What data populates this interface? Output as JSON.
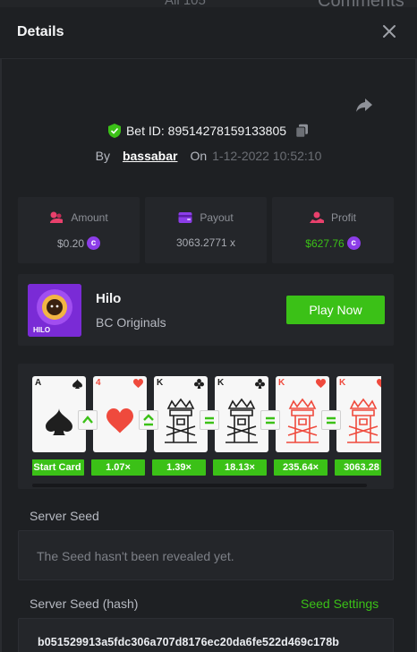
{
  "background_header": {
    "left_text": "All 105",
    "right_text": "Comments"
  },
  "header": {
    "title": "Details",
    "close_icon": "close-icon"
  },
  "share_icon": "share-icon",
  "bet": {
    "id_label": "Bet ID: 89514278159133805",
    "by_label": "By",
    "user": "bassabar",
    "on_label": "On",
    "date": "1-12-2022 10:52:10"
  },
  "stats": [
    {
      "label": "Amount",
      "value": "$0.20",
      "icon": "amount-icon",
      "coin": true,
      "color": "#a8abb2"
    },
    {
      "label": "Payout",
      "value": "3063.2771 x",
      "icon": "wallet-icon",
      "coin": false,
      "color": "#a8abb2"
    },
    {
      "label": "Profit",
      "value": "$627.76",
      "icon": "profit-icon",
      "coin": true,
      "color": "#3bc117"
    }
  ],
  "game": {
    "thumb_label": "HILO",
    "name": "Hilo",
    "provider": "BC Originals",
    "play_label": "Play Now"
  },
  "cards": [
    {
      "rank": "A",
      "suit": "spade",
      "color": "#1f1f1f",
      "multiplier": "Start Card",
      "hint": null
    },
    {
      "rank": "4",
      "suit": "heart",
      "color": "#ef4a3d",
      "multiplier": "1.07×",
      "hint": "higher"
    },
    {
      "rank": "K",
      "suit": "club",
      "color": "#1f1f1f",
      "multiplier": "1.39×",
      "hint": "higher-equal"
    },
    {
      "rank": "K",
      "suit": "club",
      "color": "#1f1f1f",
      "multiplier": "18.13×",
      "hint": "equal"
    },
    {
      "rank": "K",
      "suit": "heart",
      "color": "#ef4a3d",
      "multiplier": "235.64×",
      "hint": "equal"
    },
    {
      "rank": "K",
      "suit": "heart",
      "color": "#ef4a3d",
      "multiplier": "3063.28",
      "hint": "equal"
    }
  ],
  "server_seed": {
    "label": "Server Seed",
    "text": "The Seed hasn't been revealed yet."
  },
  "server_seed_hash": {
    "label": "Server Seed (hash)",
    "settings_label": "Seed Settings",
    "value": "b051529913a5fdc306a707d8176ec20da6fe522d469c178b"
  },
  "colors": {
    "accent_green": "#3bc117",
    "accent_purple": "#8c3de8",
    "bg": "#1e2023",
    "panel": "#24262a"
  }
}
